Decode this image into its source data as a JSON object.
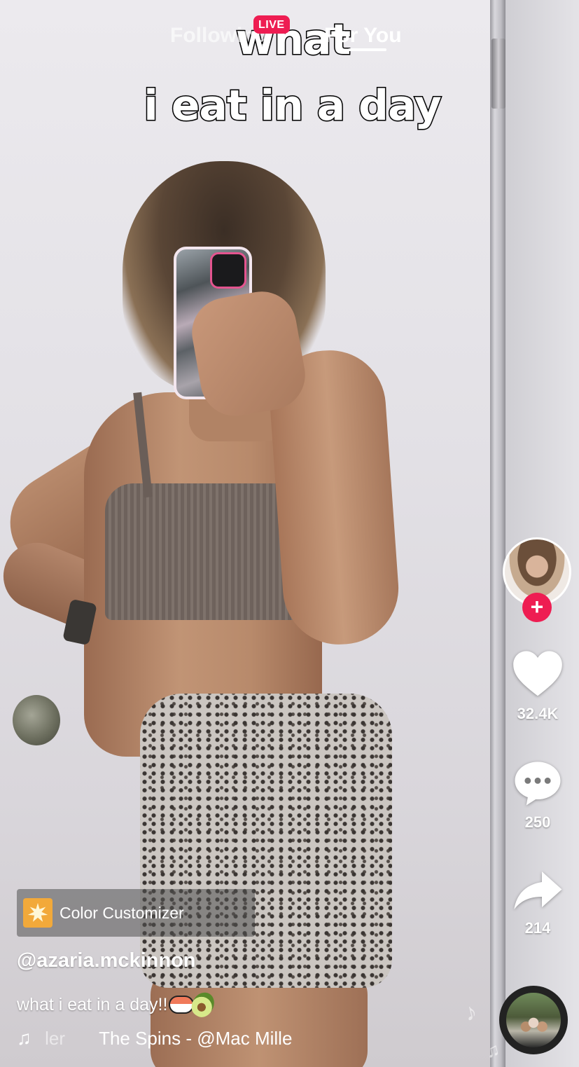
{
  "video": {
    "overlay_text_line1": "what",
    "overlay_text_line2": "i eat in a day"
  },
  "top_nav": {
    "tabs": [
      {
        "label": "Following",
        "active": false
      },
      {
        "label": "For You",
        "active": true
      }
    ],
    "live_badge": "LIVE"
  },
  "actions": {
    "like_count": "32.4K",
    "comment_count": "250",
    "share_count": "214",
    "follow_symbol": "+"
  },
  "post": {
    "effect_label": "Color Customizer",
    "username": "@azaria.mckinnon",
    "caption": "what i eat in a day!!",
    "caption_emojis": [
      "sushi",
      "avocado"
    ],
    "music_prefix": "ler",
    "music_text": "The Spins - @Mac Mille",
    "music_note": "♫"
  },
  "icons": [
    "heart-icon",
    "comment-icon",
    "share-icon",
    "music-note-icon",
    "effect-icon",
    "music-disc-icon"
  ],
  "colors": {
    "accent": "#ee1d52",
    "effect_icon_bg": "#f2a93a",
    "text": "#ffffff"
  }
}
